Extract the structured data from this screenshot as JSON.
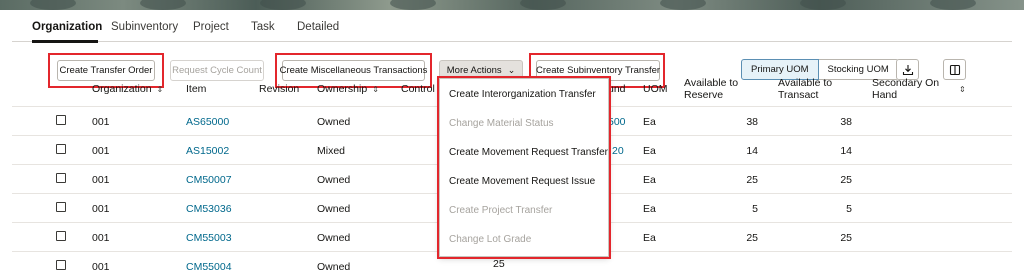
{
  "tabs": [
    {
      "label": "Organization"
    },
    {
      "label": "Subinventory"
    },
    {
      "label": "Project"
    },
    {
      "label": "Task"
    },
    {
      "label": "Detailed"
    }
  ],
  "toolbar": {
    "create_transfer_order": "Create Transfer Order",
    "request_cycle_count": "Request Cycle Count",
    "create_misc_transactions": "Create Miscellaneous Transactions",
    "more_actions": "More Actions",
    "create_subinventory_transfer": "Create Subinventory Transfer",
    "primary_uom": "Primary UOM",
    "stocking_uom": "Stocking UOM",
    "icons": [
      "download-icon",
      "columns-icon",
      "chevron-down-icon"
    ]
  },
  "table": {
    "headers": {
      "organization": "Organization",
      "item": "Item",
      "revision": "Revision",
      "ownership": "Ownership",
      "control": "Control",
      "on_hand_partial": "und",
      "uom": "UOM",
      "available_to_reserve_1": "Available to",
      "available_to_reserve_2": "Reserve",
      "available_to_transact_1": "Available to",
      "available_to_transact_2": "Transact",
      "secondary_on_hand_1": "Secondary On",
      "secondary_on_hand_2": "Hand"
    },
    "rows": [
      {
        "organization": "001",
        "item": "AS65000",
        "ownership": "Owned",
        "onhand": "500",
        "uom": "Ea",
        "reserve": "38",
        "transact": "38"
      },
      {
        "organization": "001",
        "item": "AS15002",
        "ownership": "Mixed",
        "onhand": "20",
        "uom": "Ea",
        "reserve": "14",
        "transact": "14"
      },
      {
        "organization": "001",
        "item": "CM50007",
        "ownership": "Owned",
        "onhand": "",
        "uom": "Ea",
        "reserve": "25",
        "transact": "25"
      },
      {
        "organization": "001",
        "item": "CM53036",
        "ownership": "Owned",
        "onhand": "",
        "uom": "Ea",
        "reserve": "5",
        "transact": "5"
      },
      {
        "organization": "001",
        "item": "CM55003",
        "ownership": "Owned",
        "onhand": "",
        "uom": "Ea",
        "reserve": "25",
        "transact": "25"
      },
      {
        "organization": "001",
        "item": "CM55004",
        "ownership": "Owned",
        "onhand": "",
        "uom": "Ea",
        "reserve": "",
        "transact": ""
      }
    ],
    "partial_value": "25"
  },
  "more_actions_menu": [
    {
      "label": "Create Interorganization Transfer",
      "enabled": true
    },
    {
      "label": "Change Material Status",
      "enabled": false
    },
    {
      "label": "Create Movement Request Transfer",
      "enabled": true
    },
    {
      "label": "Create Movement Request Issue",
      "enabled": true
    },
    {
      "label": "Create Project Transfer",
      "enabled": false
    },
    {
      "label": "Change Lot Grade",
      "enabled": false
    }
  ],
  "colors": {
    "link": "#00688c",
    "highlight": "#e3262c",
    "selected_toggle": "#e6f2f8"
  }
}
